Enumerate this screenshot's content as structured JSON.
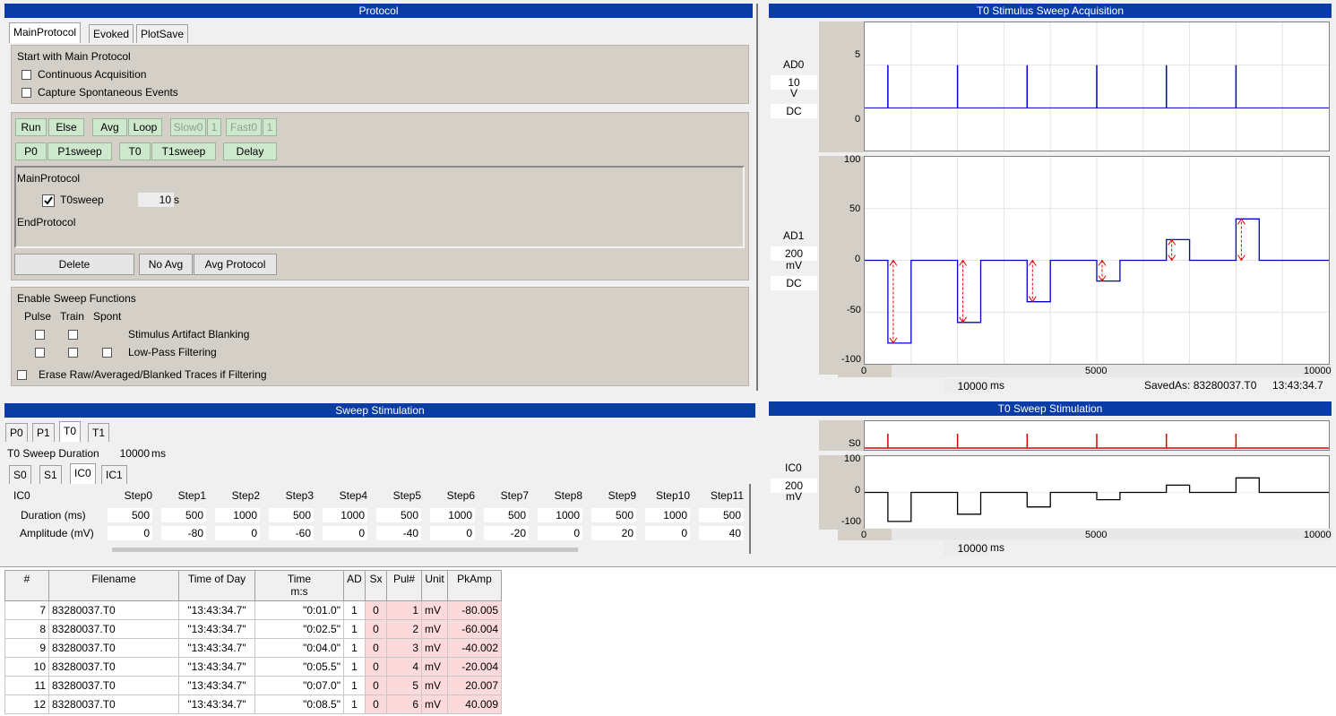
{
  "protocol": {
    "title": "Protocol",
    "tabs": [
      "MainProtocol",
      "Evoked",
      "PlotSave"
    ],
    "start_label": "Start with Main Protocol",
    "continuous_label": "Continuous Acquisition",
    "capture_label": "Capture Spontaneous Events",
    "buttons": {
      "run": "Run",
      "else": "Else",
      "avg": "Avg",
      "loop": "Loop",
      "slow0": "Slow0",
      "slow_n": "1",
      "fast0": "Fast0",
      "fast_n": "1",
      "p0": "P0",
      "p1sweep": "P1sweep",
      "t0": "T0",
      "t1sweep": "T1sweep",
      "delay": "Delay"
    },
    "list": {
      "begin": "MainProtocol",
      "item_label": "T0sweep",
      "item_value": "10",
      "item_unit": "s",
      "item_checked": true,
      "end": "EndProtocol"
    },
    "delete_label": "Delete",
    "no_avg_label": "No Avg",
    "avg_protocol_label": "Avg Protocol",
    "sweep_functions": {
      "title": "Enable Sweep Functions",
      "col_pulse": "Pulse",
      "col_train": "Train",
      "col_spont": "Spont",
      "blanking": "Stimulus Artifact Blanking",
      "lowpass": "Low-Pass Filtering",
      "erase": "Erase Raw/Averaged/Blanked Traces if Filtering"
    }
  },
  "acq": {
    "title": "T0 Stimulus Sweep Acquisition",
    "ad0": {
      "name": "AD0",
      "scale": "10",
      "unit": "V",
      "coupling": "DC"
    },
    "ad1": {
      "name": "AD1",
      "scale": "200",
      "unit": "mV",
      "coupling": "DC"
    },
    "time_window": "10000",
    "time_unit": "ms",
    "saved_as": "SavedAs: 83280037.T0",
    "clock": "13:43:34.7"
  },
  "stimpanel": {
    "title": "T0 Sweep Stimulation",
    "s0": "S0",
    "ic0": {
      "name": "IC0",
      "scale": "200",
      "unit": "mV"
    },
    "time_window": "10000",
    "time_unit": "ms"
  },
  "sweep": {
    "title": "Sweep Stimulation",
    "tabs": [
      "P0",
      "P1",
      "T0",
      "T1"
    ],
    "duration_label": "T0 Sweep Duration",
    "duration_value": "10000",
    "duration_unit": "ms",
    "subtabs": [
      "S0",
      "S1",
      "IC0",
      "IC1"
    ],
    "table_corner": "IC0",
    "steps": [
      "Step0",
      "Step1",
      "Step2",
      "Step3",
      "Step4",
      "Step5",
      "Step6",
      "Step7",
      "Step8",
      "Step9",
      "Step10",
      "Step11"
    ],
    "duration_row_label": "Duration (ms)",
    "amplitude_row_label": "Amplitude (mV)",
    "durations": [
      "500",
      "500",
      "1000",
      "500",
      "1000",
      "500",
      "1000",
      "500",
      "1000",
      "500",
      "1000",
      "500"
    ],
    "amplitudes": [
      "0",
      "-80",
      "0",
      "-60",
      "0",
      "-40",
      "0",
      "-20",
      "0",
      "20",
      "0",
      "40"
    ]
  },
  "chart_data": [
    {
      "type": "line",
      "ylabel": "AD0",
      "ylim": [
        -5,
        10
      ],
      "xlim": [
        0,
        10000
      ],
      "yticks": [
        "5",
        "0"
      ],
      "xticks": [],
      "series": [
        {
          "pulses_at_ms": [
            500,
            2000,
            3500,
            5000,
            6500,
            8000
          ],
          "pulse_amplitude": 5
        }
      ]
    },
    {
      "type": "line",
      "ylabel": "AD1",
      "ylim": [
        -100,
        100
      ],
      "xlim": [
        0,
        10000
      ],
      "yticks": [
        "100",
        "50",
        "0",
        "-50",
        "-100"
      ],
      "xticks": [
        "0",
        "5000",
        "10000"
      ],
      "series": [
        {
          "steps": [
            [
              0,
              0
            ],
            [
              500,
              -80
            ],
            [
              1000,
              0
            ],
            [
              2000,
              -60
            ],
            [
              2500,
              0
            ],
            [
              3500,
              -40
            ],
            [
              4000,
              0
            ],
            [
              5000,
              -20
            ],
            [
              5500,
              0
            ],
            [
              6500,
              20
            ],
            [
              7000,
              0
            ],
            [
              8000,
              40
            ],
            [
              8500,
              0
            ],
            [
              10000,
              0
            ]
          ]
        }
      ]
    },
    {
      "type": "line",
      "ylabel": "S0",
      "xlim": [
        0,
        10000
      ],
      "yticks": [
        "S0"
      ],
      "series": [
        {
          "pulses_at_ms": [
            500,
            2000,
            3500,
            5000,
            6500,
            8000
          ]
        }
      ]
    },
    {
      "type": "line",
      "ylabel": "IC0",
      "ylim": [
        -100,
        100
      ],
      "xlim": [
        0,
        10000
      ],
      "yticks": [
        "100",
        "0",
        "-100"
      ],
      "xticks": [
        "0",
        "5000",
        "10000"
      ],
      "series": [
        {
          "steps": [
            [
              0,
              0
            ],
            [
              500,
              -80
            ],
            [
              1000,
              0
            ],
            [
              2000,
              -60
            ],
            [
              2500,
              0
            ],
            [
              3500,
              -40
            ],
            [
              4000,
              0
            ],
            [
              5000,
              -20
            ],
            [
              5500,
              0
            ],
            [
              6500,
              20
            ],
            [
              7000,
              0
            ],
            [
              8000,
              40
            ],
            [
              8500,
              0
            ],
            [
              10000,
              0
            ]
          ]
        }
      ]
    }
  ],
  "results": {
    "headers": [
      "#",
      "Filename",
      "Time of Day",
      "Time",
      "AD",
      "Sx",
      "Pul#",
      "Unit",
      "PkAmp"
    ],
    "time_sub": "m:s",
    "rows": [
      [
        "7",
        "83280037.T0",
        "\"13:43:34.7\"",
        "\"0:01.0\"",
        "1",
        "0",
        "1",
        "mV",
        "-80.005"
      ],
      [
        "8",
        "83280037.T0",
        "\"13:43:34.7\"",
        "\"0:02.5\"",
        "1",
        "0",
        "2",
        "mV",
        "-60.004"
      ],
      [
        "9",
        "83280037.T0",
        "\"13:43:34.7\"",
        "\"0:04.0\"",
        "1",
        "0",
        "3",
        "mV",
        "-40.002"
      ],
      [
        "10",
        "83280037.T0",
        "\"13:43:34.7\"",
        "\"0:05.5\"",
        "1",
        "0",
        "4",
        "mV",
        "-20.004"
      ],
      [
        "11",
        "83280037.T0",
        "\"13:43:34.7\"",
        "\"0:07.0\"",
        "1",
        "0",
        "5",
        "mV",
        "20.007"
      ],
      [
        "12",
        "83280037.T0",
        "\"13:43:34.7\"",
        "\"0:08.5\"",
        "1",
        "0",
        "6",
        "mV",
        "40.009"
      ]
    ]
  },
  "colors": {
    "title_bar": "#0a3ca8",
    "panel": "#d4d0c8",
    "button_green": "#cde8cc",
    "trace_blue": "#0000cc",
    "marker_red": "#dd0000",
    "pink": "#fcd9da"
  }
}
